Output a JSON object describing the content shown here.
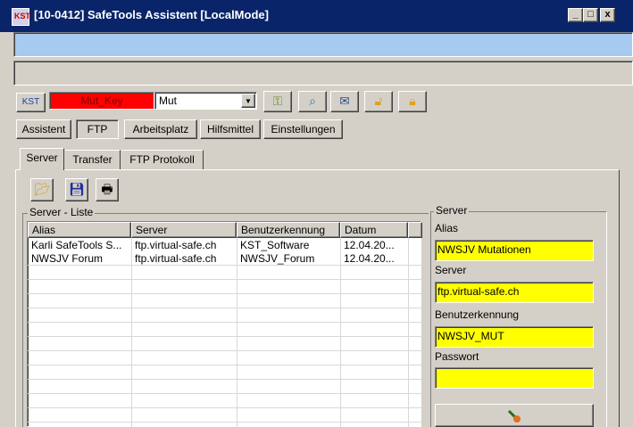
{
  "window": {
    "title": "[10-0412] SafeTools Assistent [LocalMode]",
    "icon_text": "KST",
    "caption_buttons": [
      "_",
      "□",
      "x"
    ]
  },
  "toolbar": {
    "kst_label": "KST",
    "mut_key_label": "Mut_Key",
    "mut_combo_value": "Mut",
    "icons": [
      "key-icon",
      "magnifier-icon",
      "envelope-icon",
      "lock-open-icon",
      "lock-closed-icon"
    ]
  },
  "nav": {
    "buttons": [
      "Assistent",
      "FTP",
      "Arbeitsplatz",
      "Hilfsmittel",
      "Einstellungen"
    ],
    "active": "FTP"
  },
  "tabs": {
    "items": [
      "Server",
      "Transfer",
      "FTP Protokoll"
    ],
    "active": "Server"
  },
  "server_list": {
    "group_title": "Server - Liste",
    "columns": [
      "Alias",
      "Server",
      "Benutzerkennung",
      "Datum"
    ],
    "rows": [
      [
        "Karli SafeTools S...",
        "ftp.virtual-safe.ch",
        "KST_Software",
        "12.04.20..."
      ],
      [
        "NWSJV Forum",
        "ftp.virtual-safe.ch",
        "NWSJV_Forum",
        "12.04.20..."
      ]
    ]
  },
  "server_detail": {
    "group_title": "Server",
    "alias_label": "Alias",
    "alias_value": "NWSJV Mutationen",
    "server_label": "Server",
    "server_value": "ftp.virtual-safe.ch",
    "user_label": "Benutzerkennung",
    "user_value": "NWSJV_MUT",
    "password_label": "Passwort",
    "password_value": ""
  },
  "colors": {
    "titlebar": "#0a246a",
    "mut_key_bg": "#ff0000",
    "field_bg": "#ffff00",
    "info_bar": "#a6caf0"
  }
}
